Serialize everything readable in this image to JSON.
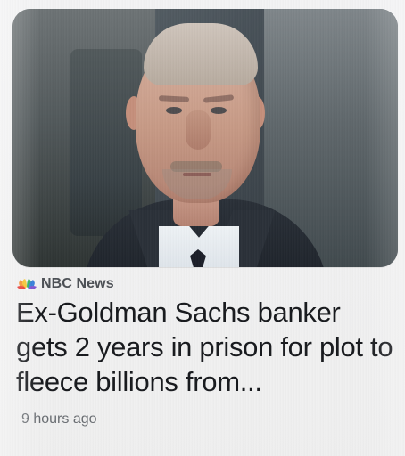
{
  "news_card": {
    "source_name": "NBC News",
    "headline": "Ex-Goldman Sachs banker gets 2 years in prison for plot to fleece billions from...",
    "timestamp": "9 hours ago",
    "image_name": "man-portrait-image",
    "source_icon": "nbc-peacock-icon"
  },
  "colors": {
    "background": "#eef0f1",
    "headline_text": "#17191d",
    "source_text": "#4c5055",
    "timestamp_text": "#6a6e73",
    "nbc_red": "#e6322d",
    "nbc_orange": "#f28c28",
    "nbc_yellow": "#f5c42c",
    "nbc_green": "#2eae5a",
    "nbc_blue": "#2f7ad8",
    "nbc_purple": "#7b4fcf"
  }
}
